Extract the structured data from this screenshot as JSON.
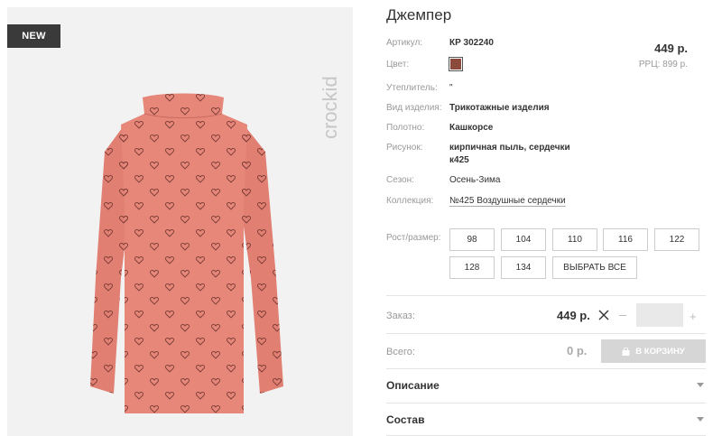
{
  "badge": "NEW",
  "brand_logo_text": "crockid",
  "product": {
    "title": "Джемпер",
    "price": "449 р.",
    "rrp": "РРЦ: 899 р.",
    "color_hex": "#8b4a3b"
  },
  "attributes": {
    "article_label": "Артикул:",
    "article_value": "КР 302240",
    "color_label": "Цвет:",
    "insulation_label": "Утеплитель:",
    "insulation_value": "\"",
    "type_label": "Вид изделия:",
    "type_value": "Трикотажные изделия",
    "fabric_label": "Полотно:",
    "fabric_value": "Кашкорсе",
    "pattern_label": "Рисунок:",
    "pattern_value_line1": "кирпичная пыль, сердечки",
    "pattern_value_line2": "к425",
    "season_label": "Сезон:",
    "season_value": "Осень-Зима",
    "collection_label": "Коллекция:",
    "collection_value": "№425 Воздушные сердечки"
  },
  "sizes": {
    "label": "Рост/размер:",
    "options": [
      "98",
      "104",
      "110",
      "116",
      "122",
      "128",
      "134"
    ],
    "select_all": "ВЫБРАТЬ ВСЕ"
  },
  "order": {
    "label": "Заказ:",
    "price": "449 р.",
    "quantity": "",
    "total_label": "Всего:",
    "total_value": "0 р.",
    "cart_button": "В КОРЗИНУ"
  },
  "accordion": {
    "description": "Описание",
    "composition": "Состав"
  }
}
